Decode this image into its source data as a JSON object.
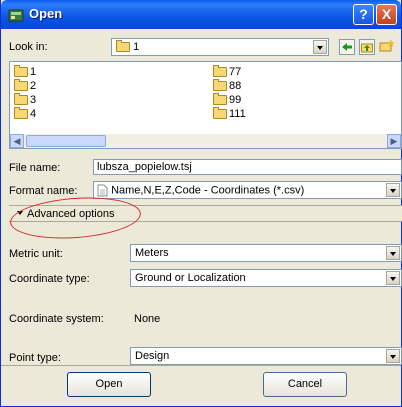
{
  "window": {
    "title": "Open",
    "help_button": "?",
    "close_button": "X"
  },
  "look_in": {
    "label": "Look in:",
    "value": "1"
  },
  "toolbar": {
    "back_icon": "back-arrow-icon",
    "up_icon": "up-folder-icon",
    "new_folder_icon": "new-folder-icon"
  },
  "files": {
    "column1": [
      "1",
      "2",
      "3",
      "4"
    ],
    "column2": [
      "77",
      "88",
      "99",
      "111"
    ]
  },
  "file_name": {
    "label": "File name:",
    "value": "lubsza_popielow.tsj"
  },
  "format_name": {
    "label": "Format name:",
    "value": "Name,N,E,Z,Code - Coordinates (*.csv)"
  },
  "advanced_options": {
    "label": "Advanced options"
  },
  "metric_unit": {
    "label": "Metric unit:",
    "value": "Meters"
  },
  "coordinate_type": {
    "label": "Coordinate type:",
    "value": "Ground or Localization"
  },
  "coordinate_system": {
    "label": "Coordinate system:",
    "value": "None"
  },
  "point_type": {
    "label": "Point type:",
    "value": "Design"
  },
  "buttons": {
    "open": "Open",
    "cancel": "Cancel"
  },
  "colors": {
    "titlebar": "#0b55e5",
    "dialog_bg": "#ece9d8",
    "annotation_circle": "#d42a2a"
  }
}
